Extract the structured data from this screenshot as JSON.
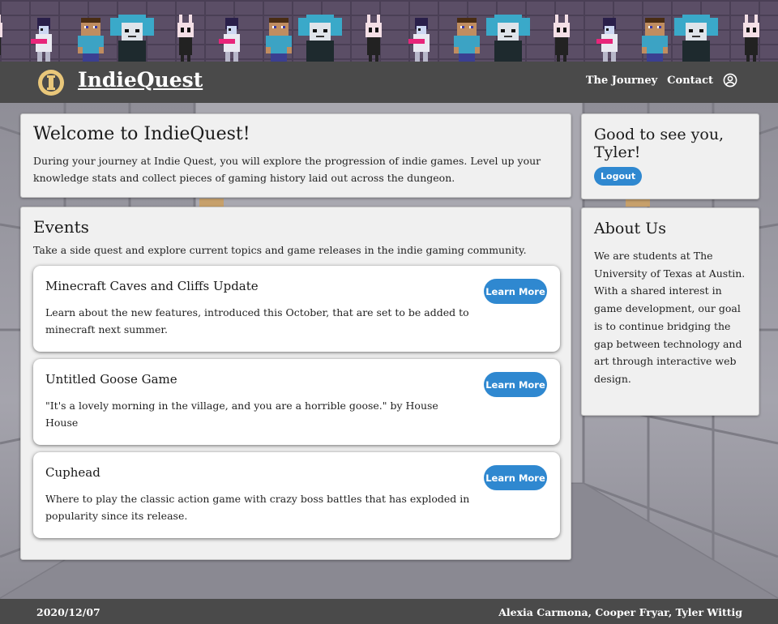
{
  "header": {
    "brand": "IndieQuest",
    "nav": [
      {
        "label": "The Journey"
      },
      {
        "label": "Contact"
      }
    ],
    "profile_icon": "user-circle-icon",
    "logo_icon": "quest-logo-icon"
  },
  "banner": {
    "characters": [
      "knight-sprite",
      "steve-sprite",
      "teal-hair-sprite",
      "hollow-knight-sprite"
    ]
  },
  "welcome": {
    "title": "Welcome to IndieQuest!",
    "text": "During your journey at Indie Quest, you will explore the progression of indie games. Level up your knowledge stats and collect pieces of gaming history laid out across the dungeon."
  },
  "events": {
    "title": "Events",
    "intro": "Take a side quest and explore current topics and game releases in the indie gaming community.",
    "items": [
      {
        "title": "Minecraft Caves and Cliffs Update",
        "text": "Learn about the new features, introduced this October, that are set to be added to minecraft next summer.",
        "button": "Learn More"
      },
      {
        "title": "Untitled Goose Game",
        "text": "\"It's a lovely morning in the village, and you are a horrible goose.\" by House House",
        "button": "Learn More"
      },
      {
        "title": "Cuphead",
        "text": "Where to play the classic action game with crazy boss battles that has exploded in popularity since its release.",
        "button": "Learn More"
      }
    ]
  },
  "greeting": {
    "title": "Good to see you, Tyler!",
    "logout": "Logout"
  },
  "about": {
    "title": "About Us",
    "text": "We are students at The University of Texas at Austin. With a shared interest in game development, our goal is to continue bridging the gap between technology and art through interactive web design."
  },
  "footer": {
    "date": "2020/12/07",
    "credits": "Alexia Carmona, Cooper Fryar, Tyler Wittig"
  },
  "colors": {
    "accent": "#2f88d0",
    "nav_bg": "#4a4a4a",
    "panel_bg": "#f0f0f0"
  }
}
